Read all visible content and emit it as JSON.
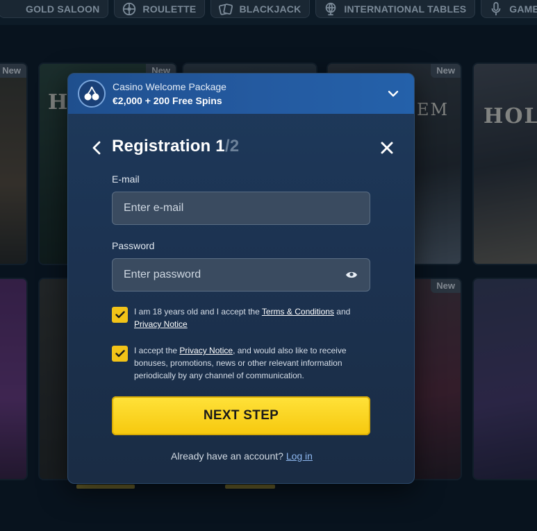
{
  "categories": [
    {
      "label": "GOLD SALOON",
      "icon": "saloon-icon"
    },
    {
      "label": "ROULETTE",
      "icon": "roulette-icon"
    },
    {
      "label": "BLACKJACK",
      "icon": "cards-icon"
    },
    {
      "label": "INTERNATIONAL TABLES",
      "icon": "globe-icon"
    },
    {
      "label": "GAME SHOWS",
      "icon": "microphone-icon"
    }
  ],
  "tiles": {
    "new_badge": "New",
    "words": {
      "hol": "HO",
      "em": "EM",
      "holiday": "HOL"
    }
  },
  "promo": {
    "line1": "Casino Welcome Package",
    "line2": "€2,000 + 200 Free Spins"
  },
  "registration": {
    "title": "Registration 1",
    "step_total": "/2",
    "email_label": "E-mail",
    "email_placeholder": "Enter e-mail",
    "password_label": "Password",
    "password_placeholder": "Enter password",
    "consent1_prefix": "I am 18 years old and I accept the ",
    "consent1_link1": "Terms & Conditions",
    "consent1_mid": " and ",
    "consent1_link2": "Privacy Notice",
    "consent2_prefix": "I accept the ",
    "consent2_link": "Privacy Notice",
    "consent2_suffix": ", and would also like to receive bonuses, promotions, news or other relevant information periodically by any channel of communication.",
    "next_label": "NEXT STEP",
    "login_prompt": "Already have an account? ",
    "login_link": "Log in"
  },
  "colors": {
    "accent_yellow": "#f6c80d",
    "promo_blue": "#245aa0",
    "modal_bg": "#1c3352"
  }
}
